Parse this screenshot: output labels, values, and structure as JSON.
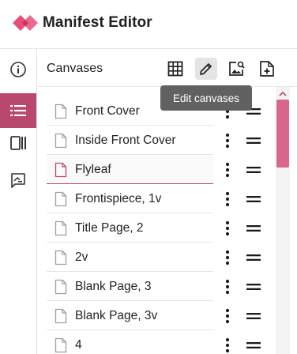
{
  "app": {
    "title": "Manifest Editor",
    "brand_color": "#e84d7a"
  },
  "rail": {
    "items": [
      {
        "icon": "info-icon",
        "active": false
      },
      {
        "icon": "list-icon",
        "active": true
      },
      {
        "icon": "layout-icon",
        "active": false
      },
      {
        "icon": "comment-icon",
        "active": false
      }
    ]
  },
  "panel": {
    "title": "Canvases",
    "toolbar": [
      {
        "icon": "grid-icon",
        "active": false
      },
      {
        "icon": "pencil-icon",
        "active": true
      },
      {
        "icon": "image-search-icon",
        "active": false
      },
      {
        "icon": "add-file-icon",
        "active": false
      }
    ],
    "tooltip": "Edit canvases"
  },
  "canvases": [
    {
      "label": "Front Cover",
      "selected": false
    },
    {
      "label": "Inside Front Cover",
      "selected": false
    },
    {
      "label": "Flyleaf",
      "selected": true
    },
    {
      "label": "Frontispiece, 1v",
      "selected": false
    },
    {
      "label": "Title Page, 2",
      "selected": false
    },
    {
      "label": "2v",
      "selected": false
    },
    {
      "label": "Blank Page, 3",
      "selected": false
    },
    {
      "label": "Blank Page, 3v",
      "selected": false
    },
    {
      "label": "4",
      "selected": false
    }
  ],
  "colors": {
    "accent": "#b8486d",
    "scroll_thumb": "#d9668c",
    "tooltip_bg": "#616161"
  }
}
